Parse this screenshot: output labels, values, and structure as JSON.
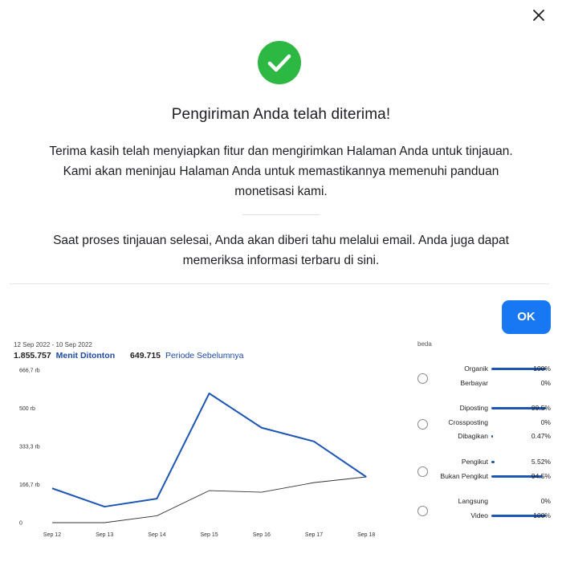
{
  "dialog": {
    "title": "Pengiriman Anda telah diterima!",
    "paragraph1_lines": [
      "Terima kasih telah menyiapkan fitur dan mengirimkan Halaman Anda untuk tinjauan.",
      "Kami akan meninjau Halaman Anda untuk memastikannya memenuhi panduan",
      "monetisasi kami."
    ],
    "paragraph2_lines": [
      "Saat proses tinjauan selesai, Anda akan diberi tahu melalui email. Anda juga dapat",
      "memeriksa informasi terbaru di sini."
    ],
    "ok_label": "OK",
    "close_icon": "close-icon",
    "success_icon": "check-circle-icon",
    "accent_color": "#1877f2",
    "success_color": "#2db843"
  },
  "stats": {
    "date_range": "12 Sep 2022 - 10 Sep 2022",
    "primary_value": "1.855.757",
    "primary_label": "Menit Ditonton",
    "secondary_value": "649.715",
    "secondary_label": "Periode Sebelumnya"
  },
  "chart_data": {
    "type": "line",
    "categories": [
      "Sep 12",
      "Sep 13",
      "Sep 14",
      "Sep 15",
      "Sep 16",
      "Sep 17",
      "Sep 18"
    ],
    "y_tick_labels": [
      "0",
      "166,7 rb",
      "333,3 rb",
      "500 rb",
      "666,7 rb"
    ],
    "ylim": [
      0,
      666700
    ],
    "series": [
      {
        "name": "Menit Ditonton",
        "color": "#1d56b4",
        "values": [
          150000,
          70000,
          105000,
          565000,
          415000,
          355000,
          200000
        ]
      },
      {
        "name": "Periode Sebelumnya",
        "color": "#333333",
        "values": [
          0,
          0,
          30000,
          140000,
          133000,
          175000,
          200000
        ]
      }
    ],
    "title": "",
    "xlabel": "",
    "ylabel": ""
  },
  "breakdown": {
    "title": "beda",
    "groups": [
      {
        "rows": [
          {
            "label": "Organik",
            "pct": "100%",
            "value": 100
          },
          {
            "label": "Berbayar",
            "pct": "0%",
            "value": 0
          }
        ]
      },
      {
        "rows": [
          {
            "label": "Diposting",
            "pct": "99.5%",
            "value": 99.5
          },
          {
            "label": "Crossposting",
            "pct": "0%",
            "value": 0
          },
          {
            "label": "Dibagikan",
            "pct": "0.47%",
            "value": 0.47
          }
        ]
      },
      {
        "rows": [
          {
            "label": "Pengikut",
            "pct": "5.52%",
            "value": 5.52
          },
          {
            "label": "Bukan Pengikut",
            "pct": "94.5%",
            "value": 94.5
          }
        ]
      },
      {
        "rows": [
          {
            "label": "Langsung",
            "pct": "0%",
            "value": 0
          },
          {
            "label": "Video",
            "pct": "100%",
            "value": 100
          }
        ]
      }
    ],
    "bar_color": "#1d56b4"
  }
}
